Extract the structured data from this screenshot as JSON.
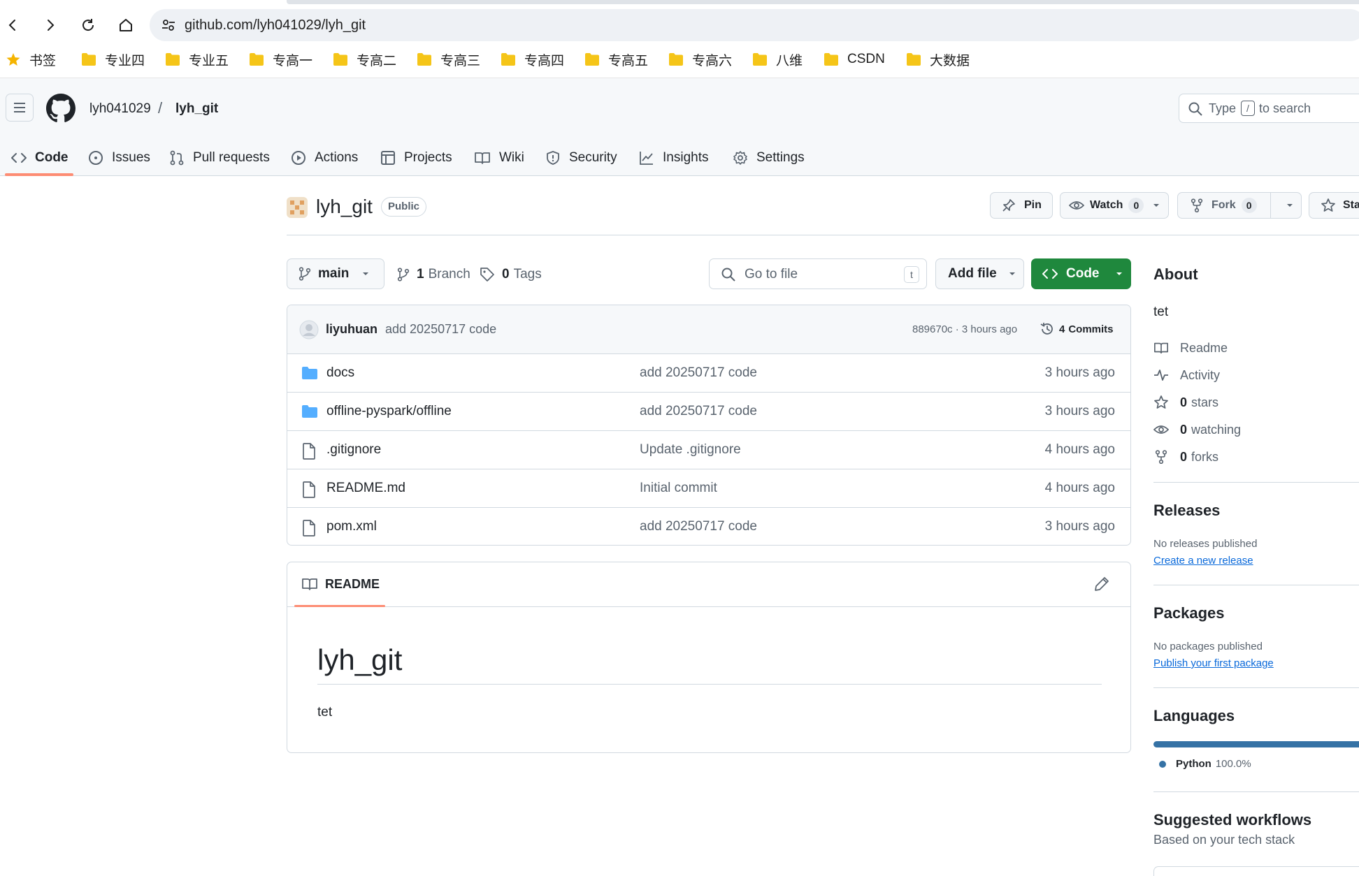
{
  "browser": {
    "url": "github.com/lyh041029/lyh_git",
    "bookmarks": [
      {
        "label": "书签",
        "type": "star"
      },
      {
        "label": "专业四",
        "type": "folder"
      },
      {
        "label": "专业五",
        "type": "folder"
      },
      {
        "label": "专高一",
        "type": "folder"
      },
      {
        "label": "专高二",
        "type": "folder"
      },
      {
        "label": "专高三",
        "type": "folder"
      },
      {
        "label": "专高四",
        "type": "folder"
      },
      {
        "label": "专高五",
        "type": "folder"
      },
      {
        "label": "专高六",
        "type": "folder"
      },
      {
        "label": "八维",
        "type": "folder"
      },
      {
        "label": "CSDN",
        "type": "folder"
      },
      {
        "label": "大数据",
        "type": "folder"
      }
    ]
  },
  "header": {
    "owner": "lyh041029",
    "separator": "/",
    "repo": "lyh_git",
    "search": {
      "prefix": "Type",
      "key": "/",
      "suffix": "to search"
    }
  },
  "nav": {
    "tabs": [
      {
        "label": "Code",
        "icon": "code-icon",
        "selected": true
      },
      {
        "label": "Issues",
        "icon": "issue-icon"
      },
      {
        "label": "Pull requests",
        "icon": "pull-request-icon"
      },
      {
        "label": "Actions",
        "icon": "play-icon"
      },
      {
        "label": "Projects",
        "icon": "table-icon"
      },
      {
        "label": "Wiki",
        "icon": "book-icon"
      },
      {
        "label": "Security",
        "icon": "shield-icon"
      },
      {
        "label": "Insights",
        "icon": "graph-icon"
      },
      {
        "label": "Settings",
        "icon": "gear-icon"
      }
    ]
  },
  "repo": {
    "title": "lyh_git",
    "visibility": "Public",
    "pin_label": "Pin",
    "watch_label": "Watch",
    "watch_count": "0",
    "fork_label": "Fork",
    "fork_count": "0",
    "star_label": "Star"
  },
  "branchbar": {
    "branch": "main",
    "branches_count": "1",
    "branches_label": "Branch",
    "tags_count": "0",
    "tags_label": "Tags",
    "goto_placeholder": "Go to file",
    "goto_key": "t",
    "add_file": "Add file",
    "code": "Code"
  },
  "commit": {
    "author": "liyuhuan",
    "message": "add 20250717 code",
    "hash_time": "889670c · 3 hours ago",
    "commits_count": "4",
    "commits_label": "Commits"
  },
  "files": [
    {
      "name": "docs",
      "type": "folder",
      "message": "add 20250717 code",
      "time": "3 hours ago"
    },
    {
      "name": "offline-pyspark/offline",
      "type": "folder",
      "message": "add 20250717 code",
      "time": "3 hours ago"
    },
    {
      "name": ".gitignore",
      "type": "file",
      "message": "Update .gitignore",
      "time": "4 hours ago"
    },
    {
      "name": "README.md",
      "type": "file",
      "message": "Initial commit",
      "time": "4 hours ago"
    },
    {
      "name": "pom.xml",
      "type": "file",
      "message": "add 20250717 code",
      "time": "3 hours ago"
    }
  ],
  "readme": {
    "tab_label": "README",
    "heading": "lyh_git",
    "body": "tet"
  },
  "about": {
    "heading": "About",
    "description": "tet",
    "readme": "Readme",
    "activity": "Activity",
    "stars_count": "0",
    "stars_label": "stars",
    "watching_count": "0",
    "watching_label": "watching",
    "forks_count": "0",
    "forks_label": "forks"
  },
  "releases": {
    "heading": "Releases",
    "empty": "No releases published",
    "link": "Create a new release"
  },
  "packages": {
    "heading": "Packages",
    "empty": "No packages published",
    "link": "Publish your first package"
  },
  "languages": {
    "heading": "Languages",
    "items": [
      {
        "name": "Python",
        "percent": "100.0%",
        "color": "#3572A5",
        "fraction": 1.0
      }
    ]
  },
  "workflows": {
    "heading": "Suggested workflows",
    "subtitle": "Based on your tech stack"
  }
}
